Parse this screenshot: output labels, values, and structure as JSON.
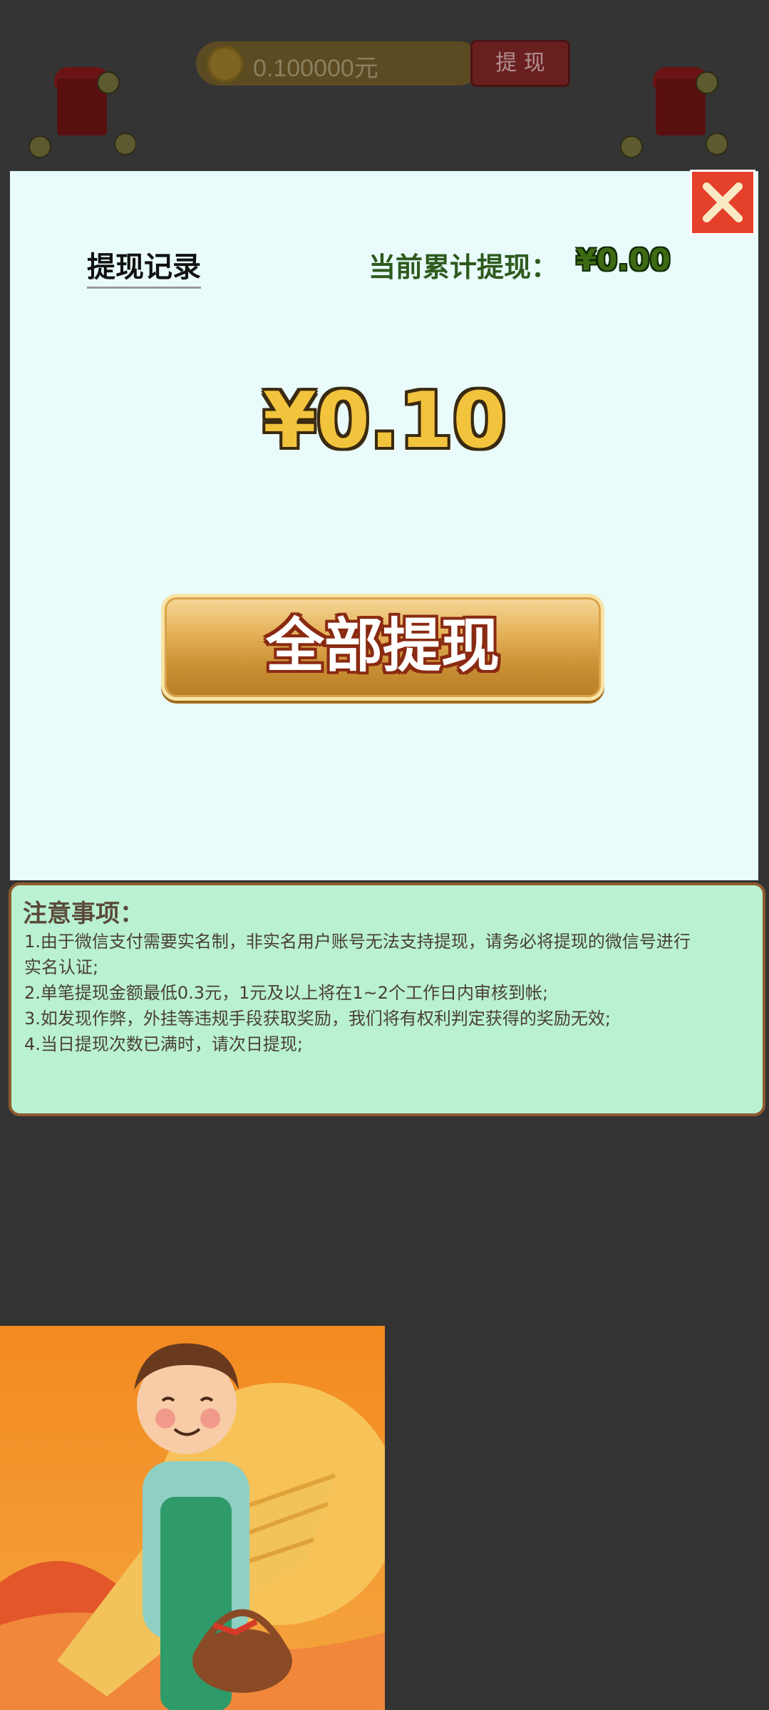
{
  "header": {
    "balance": "0.100000元",
    "withdraw_label": "提 现"
  },
  "modal": {
    "record_link": "提现记录",
    "total_label": "当前累计提现：",
    "total_value": "¥0.00",
    "amount": "¥0.10",
    "withdraw_all_label": "全部提现"
  },
  "notice": {
    "title": "注意事项：",
    "lines": [
      "1.由于微信支付需要实名制，非实名用户账号无法支持提现，请务必将提现的微信号进行",
      "实名认证;",
      "2.单笔提现金额最低0.3元，1元及以上将在1~2个工作日内审核到帐;",
      "3.如发现作弊，外挂等违规手段获取奖励，我们将有权利判定获得的奖励无效;",
      "4.当日提现次数已满时，请次日提现;"
    ]
  },
  "colors": {
    "close_button": "#e4402a",
    "modal_bg": "#e9fbfb",
    "notice_bg": "#b9f1d2",
    "amount": "#f2c33d"
  },
  "icons": {
    "coin": "coin-icon",
    "close": "close-icon",
    "red_envelope": "red-envelope-icon"
  }
}
